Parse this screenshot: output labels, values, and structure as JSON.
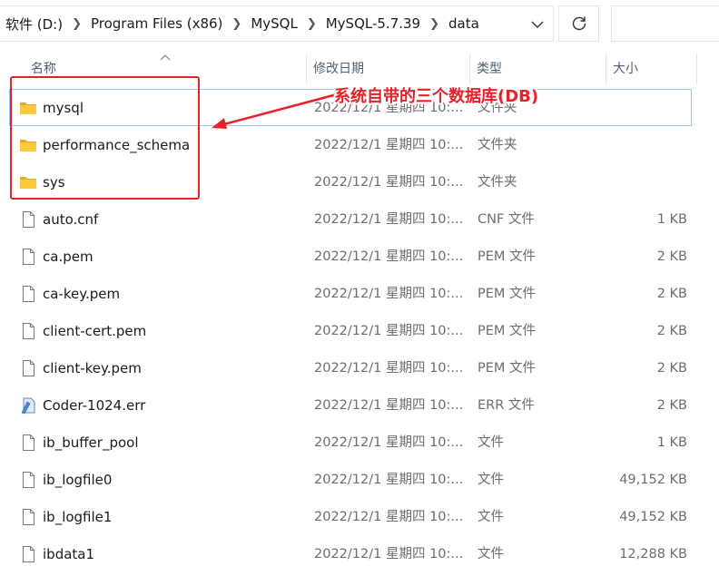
{
  "breadcrumb": [
    "软件 (D:)",
    "Program Files (x86)",
    "MySQL",
    "MySQL-5.7.39",
    "data"
  ],
  "columns": {
    "name": "名称",
    "date": "修改日期",
    "type": "类型",
    "size": "大小"
  },
  "annotation": "系统自带的三个数据库(DB)",
  "rows": [
    {
      "icon": "folder-icon",
      "name": "mysql",
      "date": "2022/12/1 星期四 10:...",
      "type": "文件夹",
      "size": ""
    },
    {
      "icon": "folder-icon",
      "name": "performance_schema",
      "date": "2022/12/1 星期四 10:...",
      "type": "文件夹",
      "size": ""
    },
    {
      "icon": "folder-icon",
      "name": "sys",
      "date": "2022/12/1 星期四 10:...",
      "type": "文件夹",
      "size": ""
    },
    {
      "icon": "file-icon",
      "name": "auto.cnf",
      "date": "2022/12/1 星期四 10:...",
      "type": "CNF 文件",
      "size": "1 KB"
    },
    {
      "icon": "file-icon",
      "name": "ca.pem",
      "date": "2022/12/1 星期四 10:...",
      "type": "PEM 文件",
      "size": "2 KB"
    },
    {
      "icon": "file-icon",
      "name": "ca-key.pem",
      "date": "2022/12/1 星期四 10:...",
      "type": "PEM 文件",
      "size": "2 KB"
    },
    {
      "icon": "file-icon",
      "name": "client-cert.pem",
      "date": "2022/12/1 星期四 10:...",
      "type": "PEM 文件",
      "size": "2 KB"
    },
    {
      "icon": "file-icon",
      "name": "client-key.pem",
      "date": "2022/12/1 星期四 10:...",
      "type": "PEM 文件",
      "size": "2 KB"
    },
    {
      "icon": "log-file-icon",
      "name": "Coder-1024.err",
      "date": "2022/12/1 星期四 10:...",
      "type": "ERR 文件",
      "size": "2 KB"
    },
    {
      "icon": "file-icon",
      "name": "ib_buffer_pool",
      "date": "2022/12/1 星期四 10:...",
      "type": "文件",
      "size": "1 KB"
    },
    {
      "icon": "file-icon",
      "name": "ib_logfile0",
      "date": "2022/12/1 星期四 10:...",
      "type": "文件",
      "size": "49,152 KB"
    },
    {
      "icon": "file-icon",
      "name": "ib_logfile1",
      "date": "2022/12/1 星期四 10:...",
      "type": "文件",
      "size": "49,152 KB"
    },
    {
      "icon": "file-icon",
      "name": "ibdata1",
      "date": "2022/12/1 星期四 10:...",
      "type": "文件",
      "size": "12,288 KB"
    }
  ],
  "colors": {
    "annotation": "#e8202a",
    "folder": "#ffc83d",
    "selected_border": "#99c9ef"
  }
}
